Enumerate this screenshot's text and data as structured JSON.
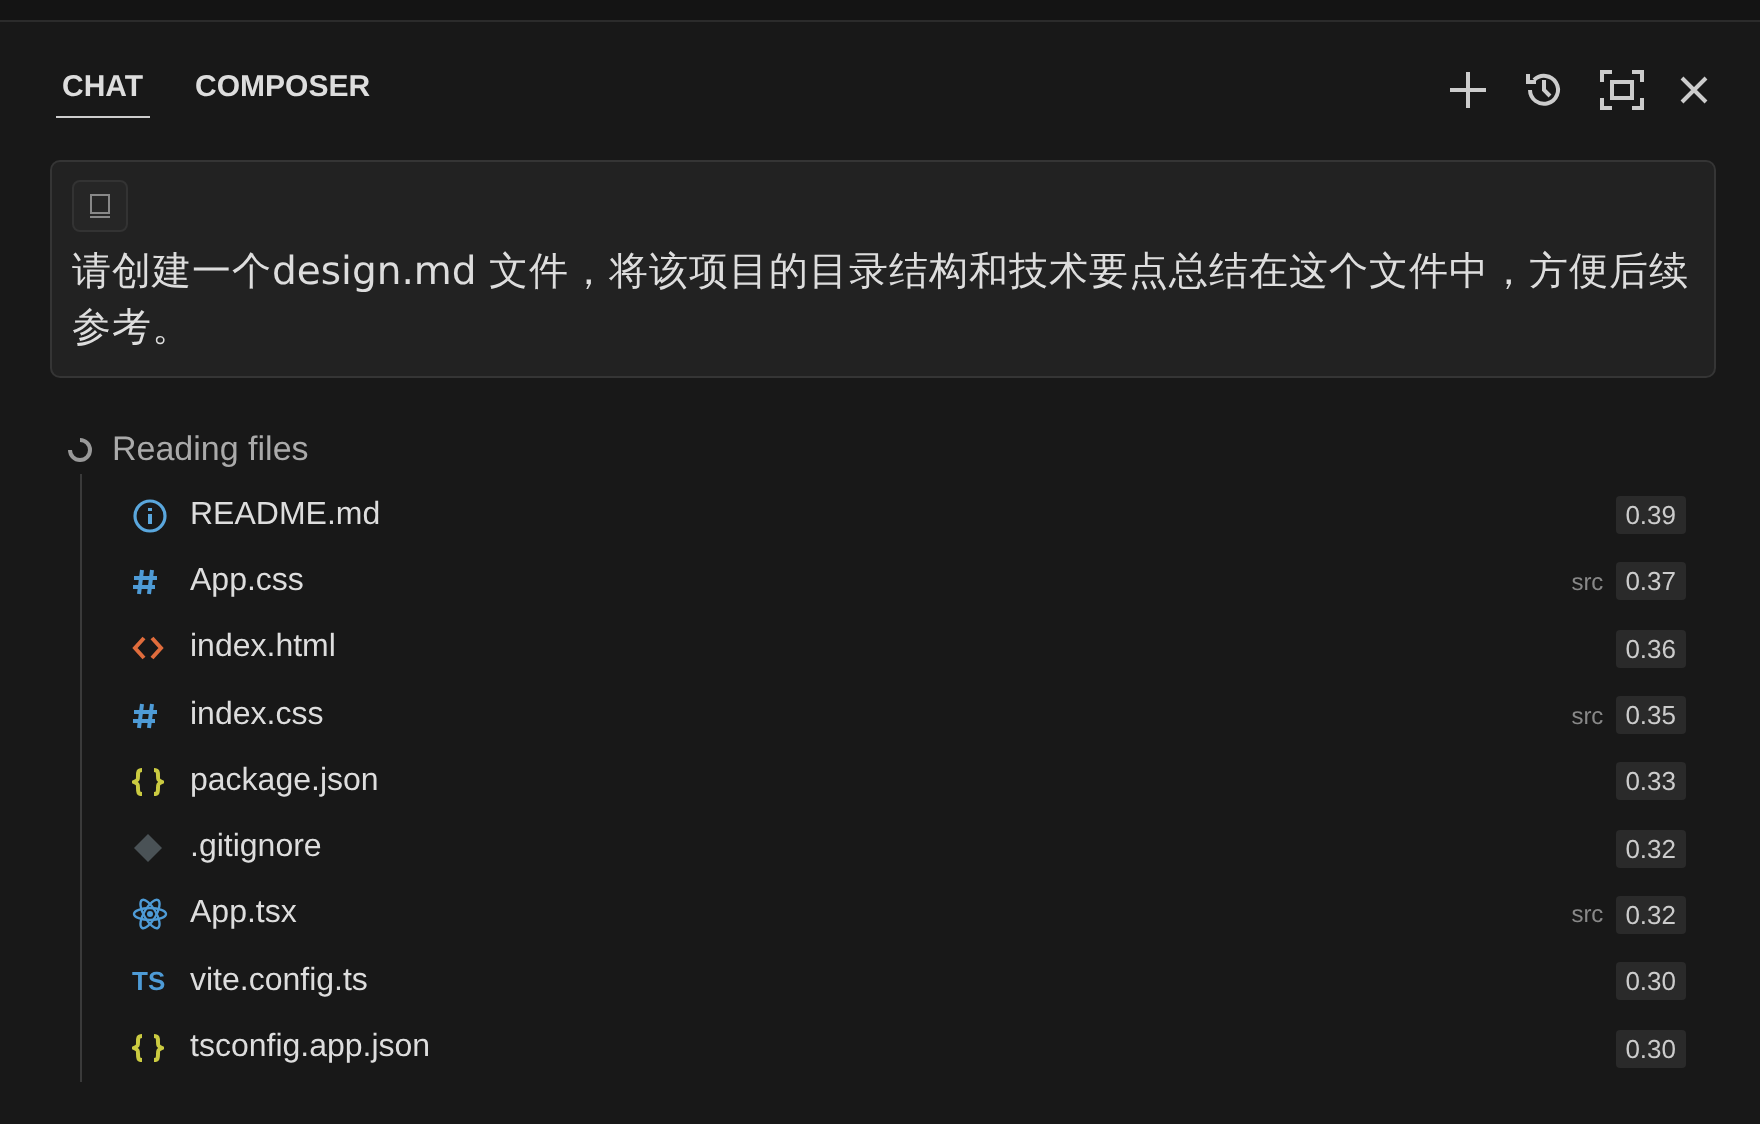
{
  "tabs": [
    {
      "label": "CHAT",
      "selected": true
    },
    {
      "label": "COMPOSER",
      "selected": false
    }
  ],
  "prompt": {
    "text": "请创建一个design.md 文件，将该项目的目录结构和技术要点总结在这个文件中，方便后续参考。"
  },
  "reading": {
    "label": "Reading files",
    "files": [
      {
        "name": "README.md",
        "kind": "info",
        "score": "0.39"
      },
      {
        "name": "App.css",
        "kind": "css",
        "folder": "src",
        "score": "0.37"
      },
      {
        "name": "index.html",
        "kind": "html",
        "score": "0.36"
      },
      {
        "name": "index.css",
        "kind": "css",
        "folder": "src",
        "score": "0.35"
      },
      {
        "name": "package.json",
        "kind": "json",
        "score": "0.33"
      },
      {
        "name": ".gitignore",
        "kind": "git",
        "score": "0.32"
      },
      {
        "name": "App.tsx",
        "kind": "react",
        "folder": "src",
        "score": "0.32"
      },
      {
        "name": "vite.config.ts",
        "kind": "ts",
        "icon_text": "TS",
        "score": "0.30"
      },
      {
        "name": "tsconfig.app.json",
        "kind": "json",
        "score": "0.30"
      }
    ]
  }
}
